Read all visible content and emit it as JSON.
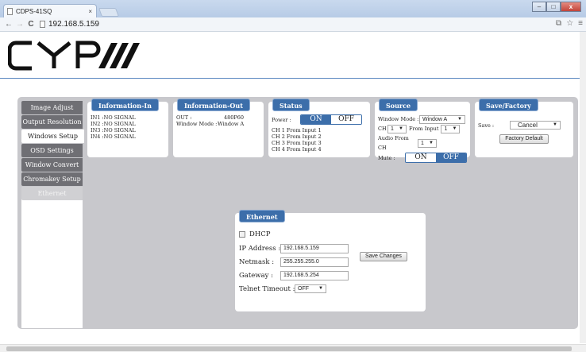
{
  "browser": {
    "tab_title": "CDPS-41SQ",
    "tab_close": "×",
    "url": "192.168.5.159",
    "back": "←",
    "forward": "→",
    "reload": "C",
    "minimize": "–",
    "maximize": "□",
    "close": "x"
  },
  "logo": {
    "brand": "CYP"
  },
  "sidebar": {
    "items": [
      {
        "label": "Image Adjust"
      },
      {
        "label": "Output Resolution"
      },
      {
        "label": "Windows Setup"
      },
      {
        "label": "OSD Settings"
      },
      {
        "label": "Window Convert"
      },
      {
        "label": "Chromakey Setup"
      },
      {
        "label": "Ethernet"
      }
    ]
  },
  "info_in": {
    "title": "Information-In",
    "lines": [
      "IN1 :NO SIGNAL",
      "IN2 :NO SIGNAL",
      "IN3 :NO SIGNAL",
      "IN4 :NO SIGNAL"
    ]
  },
  "info_out": {
    "title": "Information-Out",
    "out_label": "OUT :",
    "out_value": "480P60",
    "mode_label": "Window Mode :",
    "mode_value": "Window A"
  },
  "status": {
    "title": "Status",
    "power_label": "Power :",
    "on": "ON",
    "off": "OFF",
    "lines": [
      "CH 1 From Input  1",
      "CH 2 From Input  2",
      "CH 3 From Input  3",
      "CH 4 From Input  4"
    ]
  },
  "source": {
    "title": "Source",
    "window_mode_label": "Window Mode :",
    "window_mode_value": "Window A",
    "ch_label": "CH",
    "ch_value": "1",
    "from_input_label": "From Input",
    "from_input_value": "1",
    "audio_label": "Audio From CH",
    "audio_value": "1",
    "mute_label": "Mute :",
    "on": "ON",
    "off": "OFF"
  },
  "save_factory": {
    "title": "Save/Factory",
    "save_label": "Save :",
    "save_value": "Cancel",
    "factory_button": "Factory Default"
  },
  "ethernet": {
    "title": "Ethernet",
    "dhcp_label": "DHCP",
    "ip_label": "IP Address :",
    "ip_value": "192.168.5.159",
    "netmask_label": "Netmask :",
    "netmask_value": "255.255.255.0",
    "gateway_label": "Gateway :",
    "gateway_value": "192.168.5.254",
    "telnet_label": "Telnet Timeout :",
    "telnet_value": "OFF",
    "save_button": "Save Changes"
  },
  "colors": {
    "accent": "#3c6eaa",
    "panel": "#c8c8cc",
    "sidebar": "#6f6f74"
  }
}
